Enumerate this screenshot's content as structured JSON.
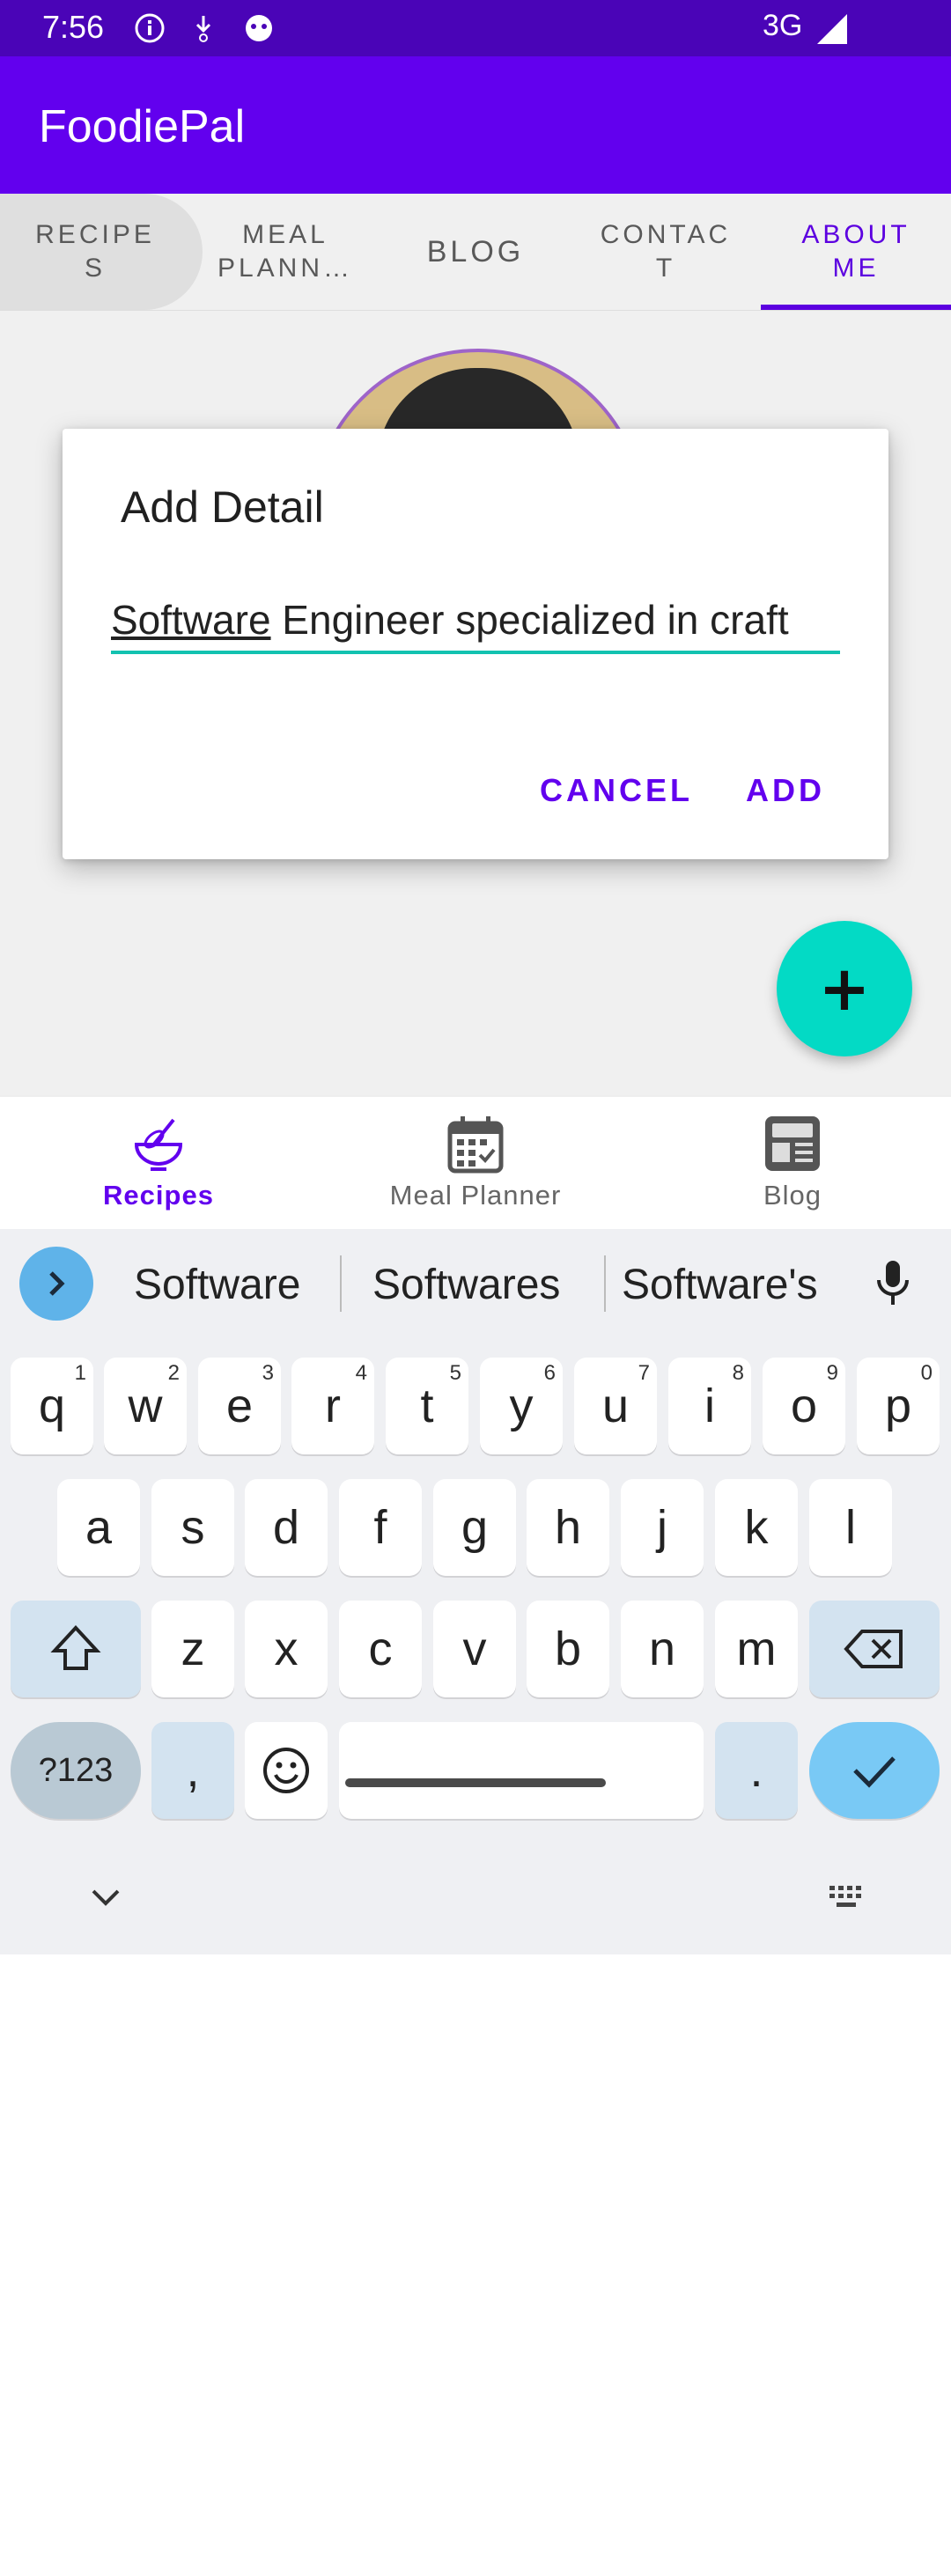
{
  "status": {
    "time": "7:56",
    "network": "3G"
  },
  "app": {
    "title": "FoodiePal"
  },
  "tabs": [
    {
      "label": "RECIPE\nS"
    },
    {
      "label": "MEAL\nPLANN…"
    },
    {
      "label": "BLOG"
    },
    {
      "label": "CONTAC\nT"
    },
    {
      "label": "ABOUT\nME",
      "active": true
    }
  ],
  "dialog": {
    "title": "Add Detail",
    "input_underlined": "Software",
    "input_rest": " Engineer specialized in craft",
    "cancel_label": "CANCEL",
    "add_label": "ADD"
  },
  "fab": {
    "label": "+"
  },
  "bottom_nav": [
    {
      "label": "Recipes",
      "icon": "whisk-bowl-icon",
      "active": true
    },
    {
      "label": "Meal Planner",
      "icon": "calendar-icon"
    },
    {
      "label": "Blog",
      "icon": "blog-icon"
    }
  ],
  "keyboard": {
    "suggestions": [
      "Software",
      "Softwares",
      "Software's"
    ],
    "row1": [
      "q",
      "w",
      "e",
      "r",
      "t",
      "y",
      "u",
      "i",
      "o",
      "p"
    ],
    "row1_hints": [
      "1",
      "2",
      "3",
      "4",
      "5",
      "6",
      "7",
      "8",
      "9",
      "0"
    ],
    "row2": [
      "a",
      "s",
      "d",
      "f",
      "g",
      "h",
      "j",
      "k",
      "l"
    ],
    "row3": [
      "z",
      "x",
      "c",
      "v",
      "b",
      "n",
      "m"
    ],
    "symbols_label": "?123",
    "comma": ",",
    "period": "."
  },
  "colors": {
    "primary": "#6200ee",
    "status_bar": "#4a04b7",
    "accent": "#03dac5"
  }
}
